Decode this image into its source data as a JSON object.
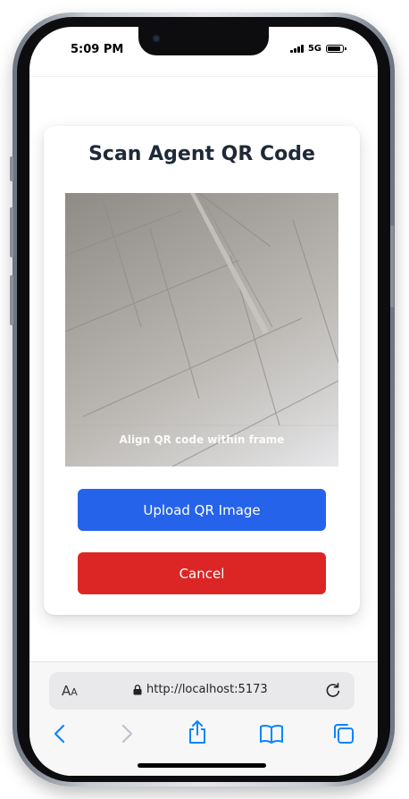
{
  "status_bar": {
    "time": "5:09 PM",
    "network": "5G"
  },
  "dialog": {
    "title": "Scan Agent QR Code",
    "camera_hint": "Align QR code within frame",
    "upload_label": "Upload QR Image",
    "cancel_label": "Cancel"
  },
  "browser": {
    "text_size_label_large": "A",
    "text_size_label_small": "A",
    "url": "http://localhost:5173"
  },
  "colors": {
    "primary": "#2563eb",
    "danger": "#dc2626",
    "browser_accent": "#0a84ff"
  },
  "icons": [
    "lock-icon",
    "reload-icon",
    "back-icon",
    "forward-icon",
    "share-icon",
    "bookmarks-icon",
    "tabs-icon"
  ]
}
